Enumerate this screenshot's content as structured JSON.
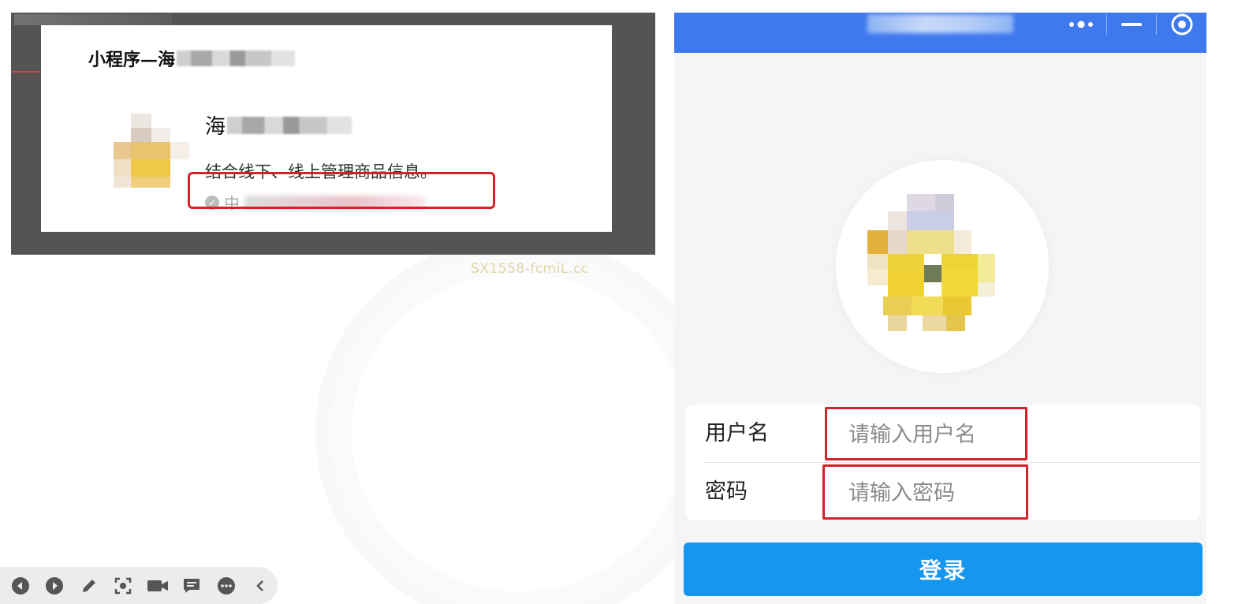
{
  "slide": {
    "title_prefix": "小程序—海",
    "app_name_prefix": "海",
    "app_description": "结合线下、线上管理商品信息。",
    "app_org_prefix": "中"
  },
  "watermark": "SX1558-fcmiL.cc",
  "toolbar": {
    "buttons": [
      "prev-icon",
      "play-icon",
      "pen-icon",
      "screenshot-icon",
      "camera-icon",
      "comment-icon",
      "more-icon",
      "collapse-icon"
    ]
  },
  "mini_program": {
    "nav_bar_color": "#3f79ee",
    "form": {
      "username_label": "用户名",
      "username_placeholder": "请输入用户名",
      "password_label": "密码",
      "password_placeholder": "请输入密码"
    },
    "login_label": "登录",
    "login_color": "#1596ef"
  },
  "colors": {
    "highlight_box": "#d2222a"
  }
}
